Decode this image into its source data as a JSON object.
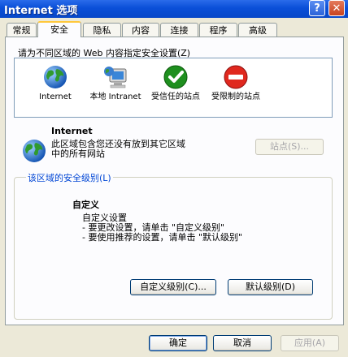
{
  "window": {
    "title": "Internet 选项",
    "help": "?",
    "close": "✕"
  },
  "tabs": [
    {
      "label": "常规"
    },
    {
      "label": "安全"
    },
    {
      "label": "隐私"
    },
    {
      "label": "内容"
    },
    {
      "label": "连接"
    },
    {
      "label": "程序"
    },
    {
      "label": "高级"
    }
  ],
  "security": {
    "instruction": "请为不同区域的 Web 内容指定安全设置(Z)",
    "zones": [
      {
        "label": "Internet",
        "icon": "globe-icon"
      },
      {
        "label": "本地 Intranet",
        "icon": "intranet-computer-icon"
      },
      {
        "label": "受信任的站点",
        "icon": "trusted-check-icon"
      },
      {
        "label": "受限制的站点",
        "icon": "restricted-stop-icon"
      }
    ],
    "selected_zone_name": "Internet",
    "selected_zone_desc_line1": "此区域包含您还没有放到其它区域",
    "selected_zone_desc_line2": "中的所有网站",
    "sites_button": "站点(S)...",
    "level_group": "该区域的安全级别(L)",
    "custom_title": "自定义",
    "custom_line1": "自定义设置",
    "custom_line2": "- 要更改设置，请单击 \"自定义级别\"",
    "custom_line3": "- 要使用推荐的设置，请单击 \"默认级别\"",
    "custom_level_button": "自定义级别(C)...",
    "default_level_button": "默认级别(D)"
  },
  "footer": {
    "ok": "确定",
    "cancel": "取消",
    "apply": "应用(A)"
  }
}
